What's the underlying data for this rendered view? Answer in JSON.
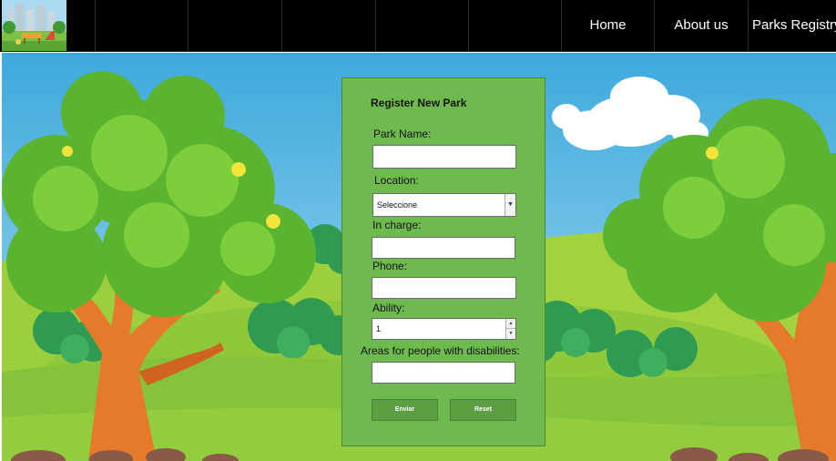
{
  "nav": {
    "links": [
      "Home",
      "About us",
      "Parks Registry"
    ]
  },
  "form": {
    "title": "Register New Park",
    "park_name_label": "Park Name:",
    "location_label": "Location:",
    "location_value": "Seleccione",
    "in_charge_label": "In charge:",
    "phone_label": "Phone:",
    "ability_label": "Ability:",
    "ability_value": "1",
    "areas_label": "Areas for people with disabilities:",
    "submit_label": "Enviar",
    "reset_label": "Reset"
  },
  "colors": {
    "navbar": "#000000",
    "form_panel": "#6fba4e",
    "button": "#5c9e42",
    "sky": "#4cb3e2",
    "grass": "#86c33a"
  },
  "icons": {
    "select_arrow": "triangle-down",
    "spinner_up": "triangle-up",
    "spinner_down": "triangle-down"
  }
}
